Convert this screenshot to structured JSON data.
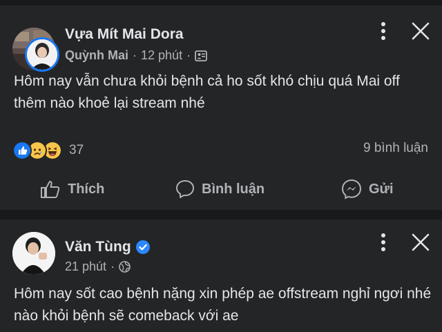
{
  "post1": {
    "page_name": "Vựa Mít Mai Dora",
    "author": "Quỳnh Mai",
    "time": "12 phút",
    "audience_icon": "page-icon",
    "text": "Hôm nay vẫn chưa khỏi bệnh cả ho sốt khó chịu quá Mai off thêm nào khoẻ lại stream nhé",
    "reactions": {
      "icons": [
        "like-icon",
        "sad-icon",
        "haha-icon"
      ],
      "count": "37"
    },
    "comments": "9 bình luận",
    "actions": {
      "like": "Thích",
      "comment": "Bình luận",
      "send": "Gửi"
    }
  },
  "post2": {
    "author": "Văn Tùng",
    "verified": true,
    "time": "21 phút",
    "audience_icon": "globe-icon",
    "text": "Hôm nay sốt cao bệnh nặng xin phép ae offstream nghỉ ngơi nhé nào khỏi bệnh sẽ comeback với ae"
  },
  "colors": {
    "background": "#18191a",
    "card": "#242526",
    "text_primary": "#e4e6eb",
    "text_secondary": "#b0b3b8",
    "like_blue": "#1877f2",
    "verified_blue": "#2d88ff"
  }
}
